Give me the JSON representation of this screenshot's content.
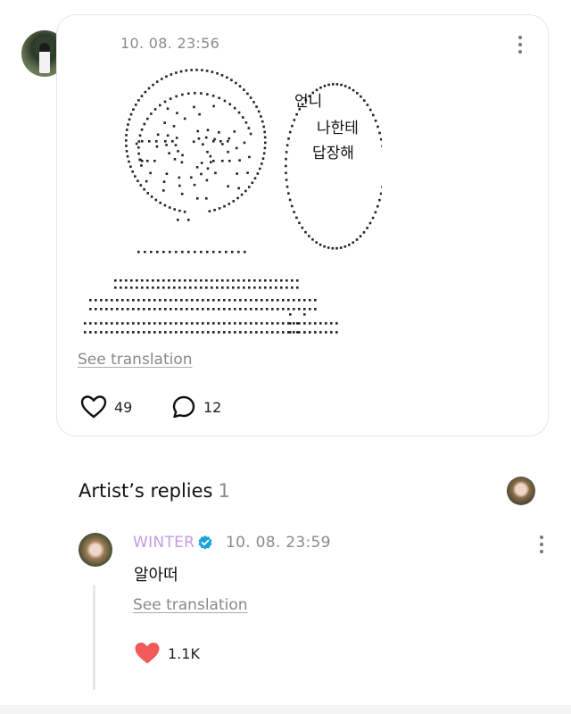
{
  "post": {
    "timestamp": "10. 08. 23:56",
    "art_caption_lines": [
      "언니",
      "나한테",
      "답장해"
    ],
    "see_translation": "See translation",
    "likes": "49",
    "comments": "12"
  },
  "replies_section": {
    "title": "Artist’s replies",
    "count": "1"
  },
  "reply": {
    "author": "WINTER",
    "timestamp": "10. 08. 23:59",
    "text": "알아떠",
    "see_translation": "See translation",
    "likes": "1.1K",
    "liked": true
  },
  "colors": {
    "artist_name": "#c39be6",
    "verified": "#1aa3d8",
    "liked_heart": "#f25a5a"
  }
}
